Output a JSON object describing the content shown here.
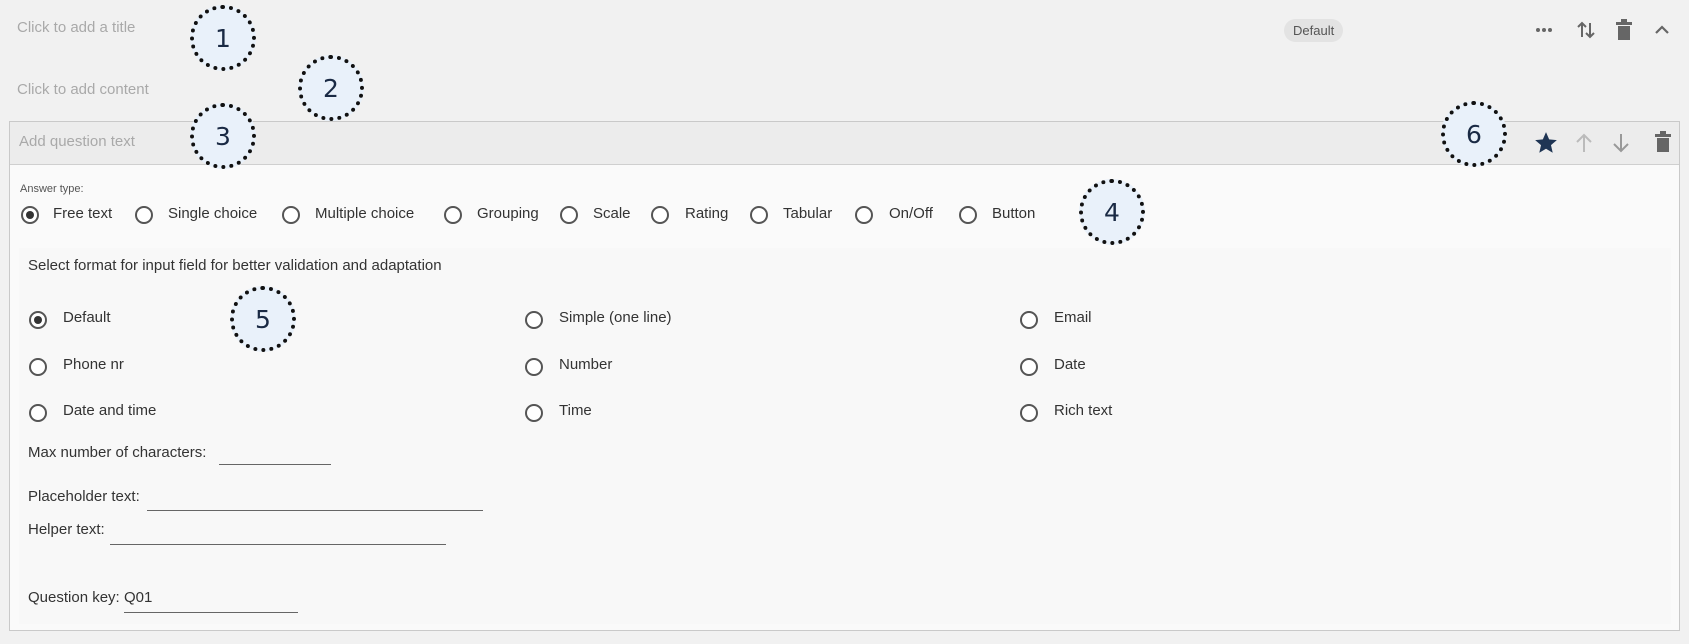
{
  "section": {
    "title_placeholder": "Click to add a title",
    "content_placeholder": "Click to add content",
    "badge": "Default",
    "icons": [
      "more-icon",
      "sort-icon",
      "trash-icon",
      "chevron-up-icon"
    ]
  },
  "question": {
    "text_placeholder": "Add question text",
    "icons": [
      "star-icon",
      "arrow-up-icon",
      "arrow-down-icon",
      "trash-icon"
    ],
    "answer_type_label": "Answer type:",
    "answer_types": [
      {
        "label": "Free text",
        "selected": true
      },
      {
        "label": "Single choice",
        "selected": false
      },
      {
        "label": "Multiple choice",
        "selected": false
      },
      {
        "label": "Grouping",
        "selected": false
      },
      {
        "label": "Scale",
        "selected": false
      },
      {
        "label": "Rating",
        "selected": false
      },
      {
        "label": "Tabular",
        "selected": false
      },
      {
        "label": "On/Off",
        "selected": false
      },
      {
        "label": "Button",
        "selected": false
      }
    ],
    "format_prompt": "Select format for input field for better validation and adaptation",
    "formats": [
      {
        "label": "Default",
        "selected": true
      },
      {
        "label": "Simple (one line)",
        "selected": false
      },
      {
        "label": "Email",
        "selected": false
      },
      {
        "label": "Phone nr",
        "selected": false
      },
      {
        "label": "Number",
        "selected": false
      },
      {
        "label": "Date",
        "selected": false
      },
      {
        "label": "Date and time",
        "selected": false
      },
      {
        "label": "Time",
        "selected": false
      },
      {
        "label": "Rich text",
        "selected": false
      }
    ],
    "max_chars_label": "Max number of characters:",
    "max_chars_value": "",
    "placeholder_label": "Placeholder text:",
    "placeholder_value": "",
    "helper_label": "Helper text:",
    "helper_value": "",
    "key_label": "Question key:",
    "key_value": "Q01"
  },
  "callouts": [
    "1",
    "2",
    "3",
    "4",
    "5",
    "6"
  ],
  "colors": {
    "background": "#f1f1f1",
    "card_header": "#ececec",
    "callout_fill": "#e9f1fa",
    "star": "#1f3554"
  }
}
